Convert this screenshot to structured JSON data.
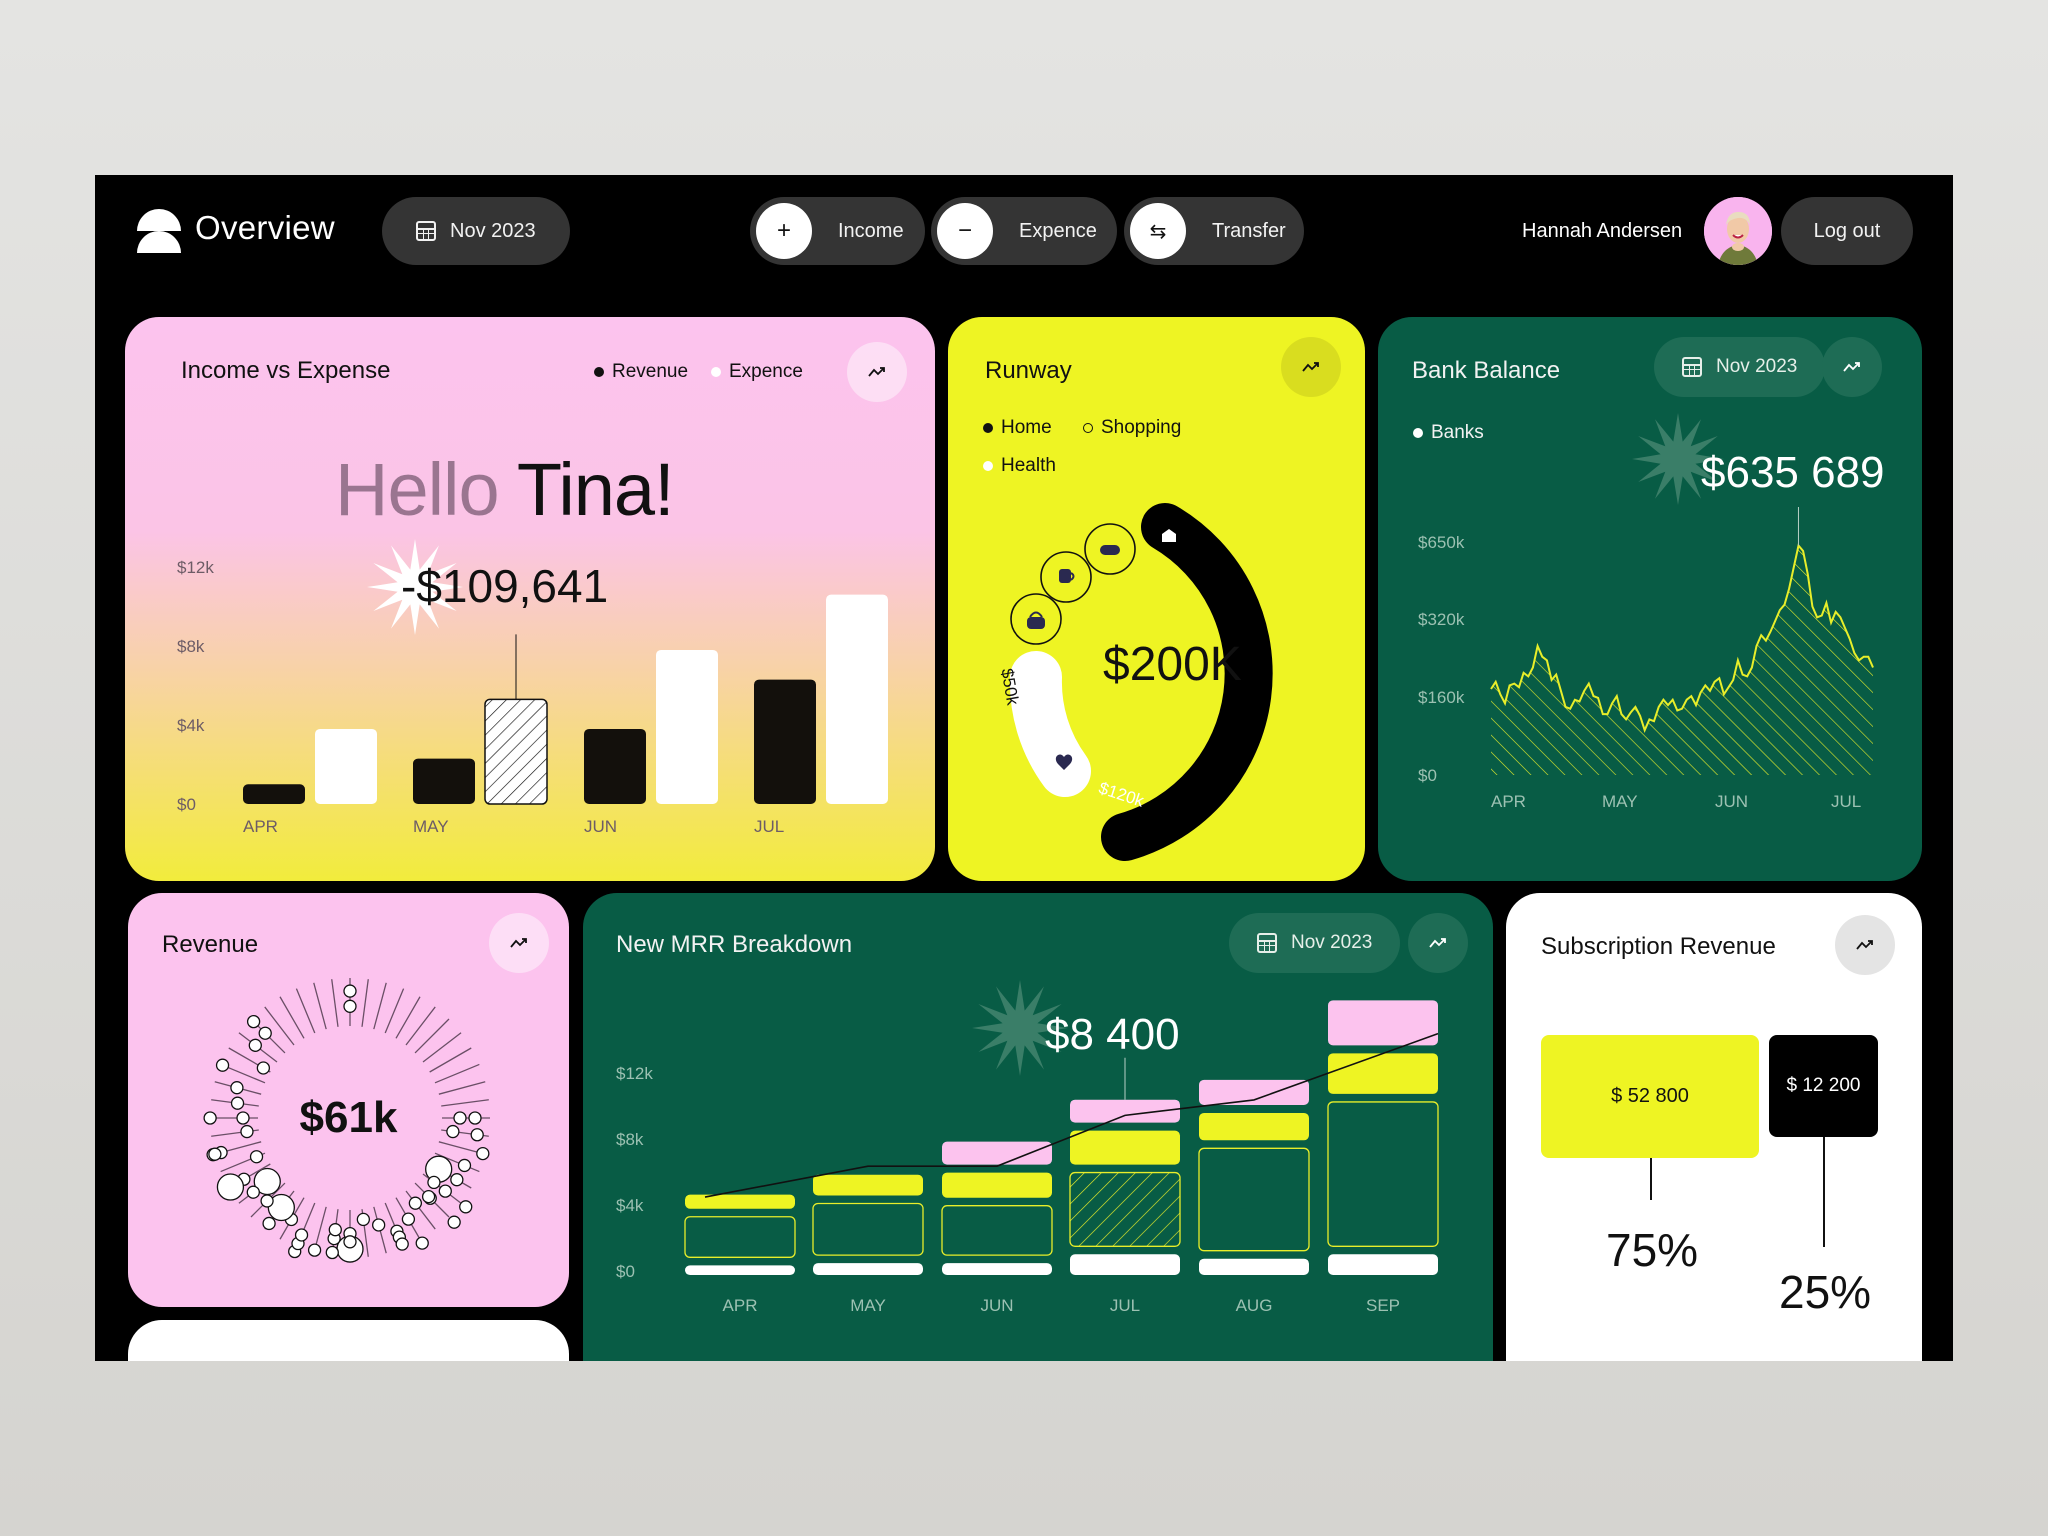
{
  "header": {
    "title": "Overview",
    "date_label": "Nov 2023",
    "actions": [
      {
        "label": "Income",
        "icon": "plus-icon"
      },
      {
        "label": "Expence",
        "icon": "minus-icon"
      },
      {
        "label": "Transfer",
        "icon": "transfer-arrows-icon"
      }
    ],
    "user_name": "Hannah Andersen",
    "logout_label": "Log out"
  },
  "income_expense": {
    "title": "Income vs Expense",
    "legend": [
      {
        "label": "Revenue",
        "color": "#111111"
      },
      {
        "label": "Expence",
        "color": "#ffffff"
      }
    ],
    "greeting_muted": "Hello",
    "greeting_name": "Tina!",
    "callout": "-$109,641"
  },
  "runway": {
    "title": "Runway",
    "legend": [
      {
        "label": "Home"
      },
      {
        "label": "Shopping"
      },
      {
        "label": "Health"
      }
    ],
    "total": "$200K",
    "segment_labels": [
      "$50k",
      "$120k"
    ]
  },
  "bank_balance": {
    "title": "Bank Balance",
    "date_label": "Nov 2023",
    "legend": "Banks",
    "callout": "$635 689"
  },
  "revenue": {
    "title": "Revenue",
    "total": "$61k"
  },
  "mrr": {
    "title": "New MRR Breakdown",
    "date_label": "Nov 2023",
    "callout": "$8 400"
  },
  "subscription": {
    "title": "Subscription Revenue",
    "items": [
      {
        "amount": "$ 52 800",
        "percent": "75%",
        "color": "#eef423"
      },
      {
        "amount": "$ 12 200",
        "percent": "25%",
        "color": "#000000"
      }
    ]
  },
  "colors": {
    "pink": "#fcc3ee",
    "yellow": "#eef423",
    "green": "#085c45",
    "pill": "#343434"
  },
  "chart_data": [
    {
      "type": "bar",
      "title": "Income vs Expense",
      "categories": [
        "APR",
        "MAY",
        "JUN",
        "JUL"
      ],
      "series": [
        {
          "name": "Revenue",
          "values": [
            1000,
            2300,
            3800,
            6300
          ]
        },
        {
          "name": "Expence",
          "values": [
            3800,
            5300,
            7800,
            10600
          ]
        }
      ],
      "highlight": {
        "category": "MAY",
        "series": "Expence",
        "label": "-$109,641"
      },
      "yticks": [
        "$0",
        "$4k",
        "$8k",
        "$12k"
      ],
      "ylim": [
        0,
        12000
      ]
    },
    {
      "type": "pie",
      "title": "Runway",
      "total": "$200K",
      "slices": [
        {
          "name": "Home",
          "value": 120,
          "label": "$120k"
        },
        {
          "name": "Health",
          "value": 50,
          "label": "$50k"
        },
        {
          "name": "Shopping",
          "value": 30
        }
      ]
    },
    {
      "type": "area",
      "title": "Bank Balance",
      "series_name": "Banks",
      "x": [
        "APR",
        "MAY",
        "JUN",
        "JUL"
      ],
      "yticks": [
        "$0",
        "$160k",
        "$320k",
        "$650k"
      ],
      "peak_label": "$635 689",
      "values": [
        240,
        260,
        225,
        200,
        250,
        255,
        245,
        285,
        275,
        300,
        360,
        330,
        320,
        265,
        280,
        235,
        190,
        185,
        210,
        205,
        235,
        255,
        220,
        215,
        170,
        170,
        200,
        220,
        170,
        155,
        175,
        190,
        165,
        125,
        155,
        150,
        190,
        210,
        195,
        210,
        180,
        185,
        210,
        220,
        195,
        230,
        250,
        235,
        260,
        270,
        225,
        245,
        265,
        320,
        280,
        275,
        300,
        360,
        390,
        375,
        400,
        430,
        460,
        475,
        520,
        580,
        640,
        625,
        560,
        470,
        440,
        445,
        480,
        425,
        455,
        440,
        410,
        380,
        340,
        320,
        330,
        330,
        300
      ],
      "ylim": [
        0,
        650
      ]
    },
    {
      "type": "bar",
      "title": "New MRR Breakdown",
      "categories": [
        "APR",
        "MAY",
        "JUN",
        "JUL",
        "AUG",
        "SEP"
      ],
      "stack_segments": [
        {
          "name": "base",
          "values": [
            800,
            900,
            900,
            1300,
            1100,
            1300
          ]
        },
        {
          "name": "outlined",
          "values": [
            2200,
            2700,
            2600,
            3700,
            5000,
            6900
          ]
        },
        {
          "name": "yellow",
          "values": [
            1000,
            1300,
            1500,
            1900,
            1600,
            2200
          ]
        },
        {
          "name": "pink",
          "values": [
            0,
            0,
            1400,
            1400,
            1500,
            2400
          ]
        }
      ],
      "trend_line": [
        3800,
        5200,
        5200,
        7500,
        8200,
        11200
      ],
      "highlight": {
        "category": "JUL",
        "label": "$8 400"
      },
      "yticks": [
        "$0",
        "$4k",
        "$8k",
        "$12k"
      ],
      "ylim": [
        0,
        12000
      ]
    },
    {
      "type": "bar",
      "title": "Subscription Revenue",
      "categories": [
        "$ 52 800",
        "$ 12 200"
      ],
      "values": [
        52800,
        12200
      ],
      "percent": [
        75,
        25
      ]
    }
  ]
}
